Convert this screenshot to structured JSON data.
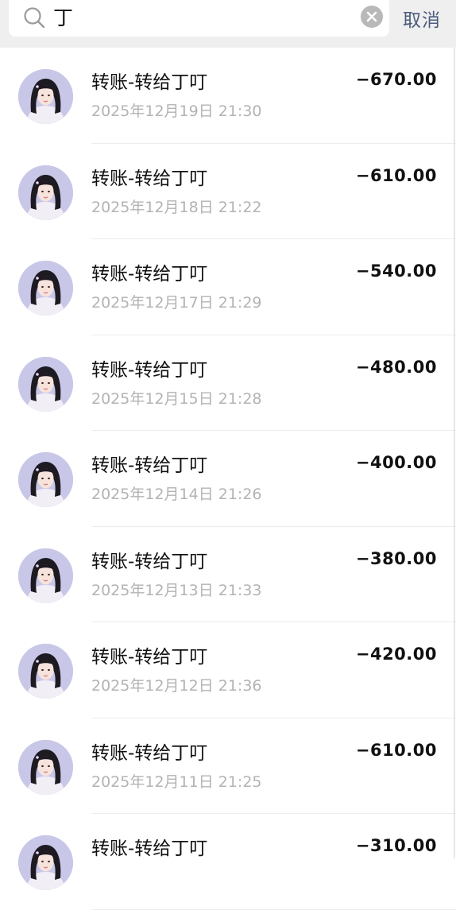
{
  "search": {
    "value": "丁",
    "cancel_label": "取消"
  },
  "transactions": [
    {
      "title": "转账-转给丁叮",
      "time": "2025年12月19日 21:30",
      "amount": "−670.00"
    },
    {
      "title": "转账-转给丁叮",
      "time": "2025年12月18日 21:22",
      "amount": "−610.00"
    },
    {
      "title": "转账-转给丁叮",
      "time": "2025年12月17日 21:29",
      "amount": "−540.00"
    },
    {
      "title": "转账-转给丁叮",
      "time": "2025年12月15日 21:28",
      "amount": "−480.00"
    },
    {
      "title": "转账-转给丁叮",
      "time": "2025年12月14日 21:26",
      "amount": "−400.00"
    },
    {
      "title": "转账-转给丁叮",
      "time": "2025年12月13日 21:33",
      "amount": "−380.00"
    },
    {
      "title": "转账-转给丁叮",
      "time": "2025年12月12日 21:36",
      "amount": "−420.00"
    },
    {
      "title": "转账-转给丁叮",
      "time": "2025年12月11日 21:25",
      "amount": "−610.00"
    },
    {
      "title": "转账-转给丁叮",
      "time": "",
      "amount": "−310.00"
    }
  ],
  "colors": {
    "accent": "#4a5b7c",
    "amount": "#111111",
    "secondary_text": "#b3b3b3"
  },
  "icons": {
    "search": "search-icon",
    "clear": "clear-icon",
    "avatar": "avatar"
  }
}
